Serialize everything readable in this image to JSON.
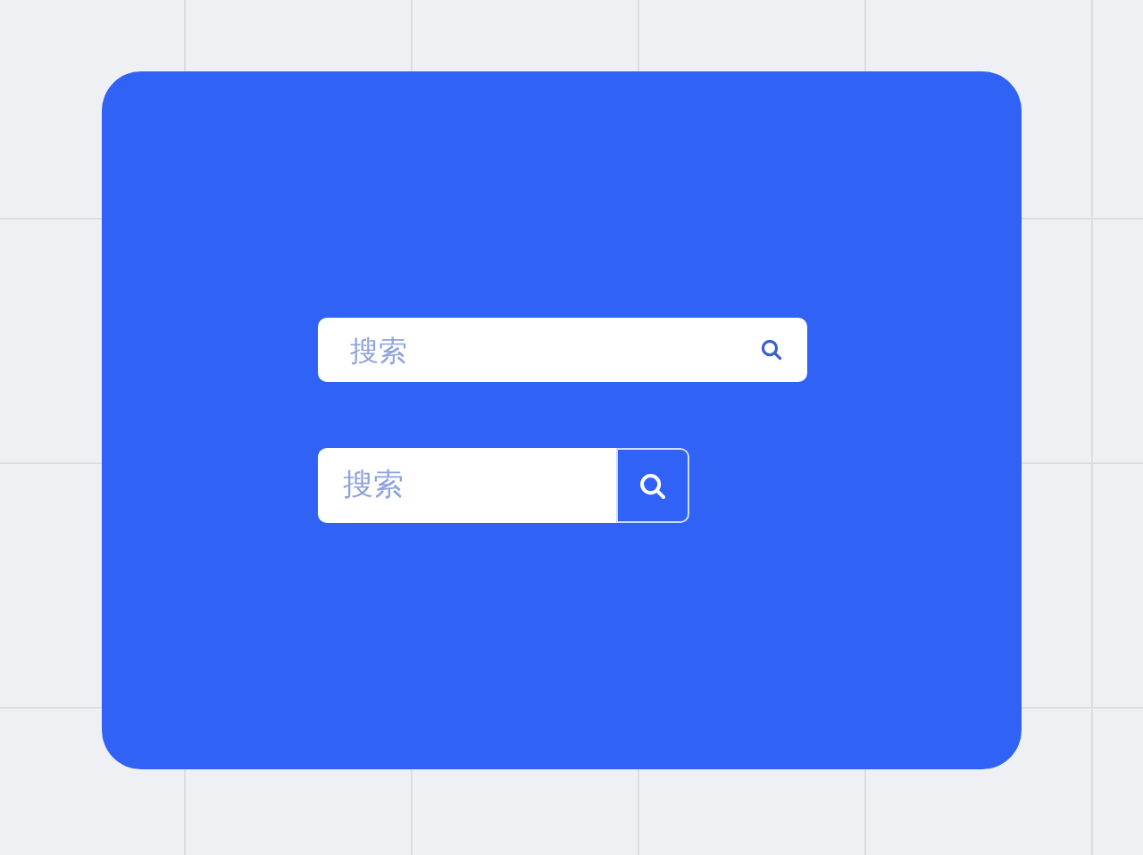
{
  "search_fields": [
    {
      "kind": "inline-icon",
      "placeholder": "搜索"
    },
    {
      "kind": "with-button",
      "placeholder": "搜索"
    }
  ]
}
